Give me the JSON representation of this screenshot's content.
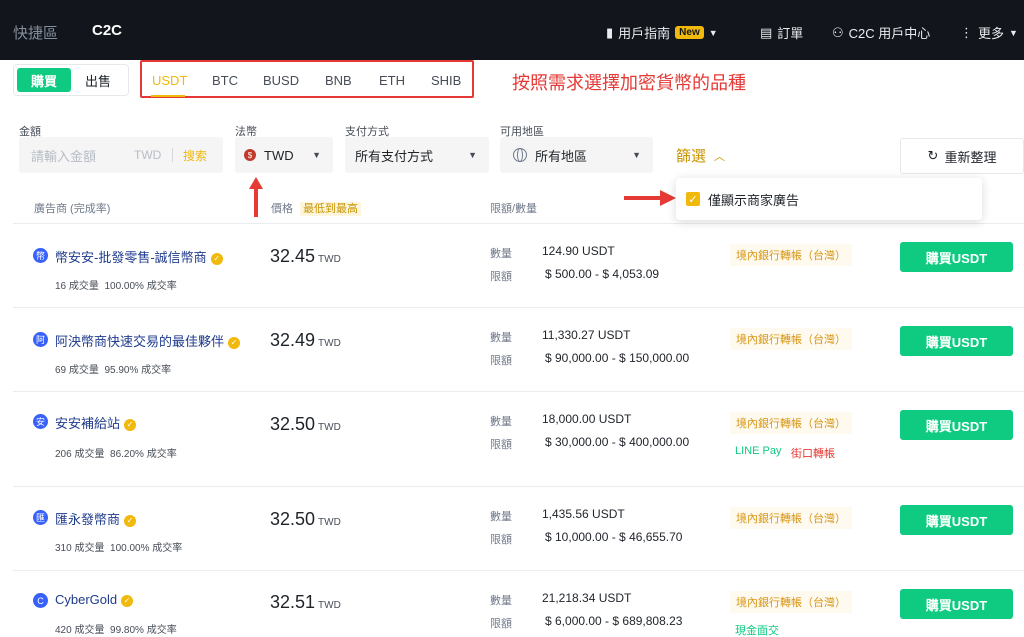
{
  "nav": {
    "left": [
      "快捷區",
      "C2C"
    ],
    "guide": "用戶指南",
    "new_badge": "New",
    "orders": "訂單",
    "user_center": "C2C 用戶中心",
    "more": "更多"
  },
  "trade": {
    "buy": "購買",
    "sell": "出售"
  },
  "coins": [
    "USDT",
    "BTC",
    "BUSD",
    "BNB",
    "ETH",
    "SHIB"
  ],
  "annotation_coin": "按照需求選擇加密貨幣的品種",
  "filters": {
    "amount_label": "金額",
    "amount_placeholder": "請輸入金額",
    "amount_unit": "TWD",
    "search": "搜索",
    "fiat_label": "法幣",
    "fiat_value": "TWD",
    "payment_label": "支付方式",
    "payment_value": "所有支付方式",
    "region_label": "可用地區",
    "region_value": "所有地區",
    "filter_toggle": "篩選",
    "refresh": "重新整理"
  },
  "popup": {
    "merchant_only": "僅顯示商家廣告"
  },
  "table": {
    "col_advertiser": "廣告商 (完成率)",
    "col_price": "價格",
    "sort": "最低到最高",
    "col_limit": "限額/數量",
    "qty_label": "數量",
    "limit_label": "限額",
    "buy_label": "購買USDT"
  },
  "rows": [
    {
      "avatar": "幣",
      "name": "幣安安-批發零售-誠信幣商",
      "trades": "16 成交量",
      "rate": "100.00% 成交率",
      "price": "32.45",
      "unit": "TWD",
      "qty": "124.90 USDT",
      "limit": "$ 500.00 - $ 4,053.09",
      "pay": [
        "境內銀行轉帳（台灣）"
      ]
    },
    {
      "avatar": "阿",
      "name": "阿泱幣商快速交易的最佳夥伴",
      "trades": "69 成交量",
      "rate": "95.90% 成交率",
      "price": "32.49",
      "unit": "TWD",
      "qty": "11,330.27 USDT",
      "limit": "$ 90,000.00 - $ 150,000.00",
      "pay": [
        "境內銀行轉帳（台灣）"
      ]
    },
    {
      "avatar": "安",
      "name": "安安補給站",
      "trades": "206 成交量",
      "rate": "86.20% 成交率",
      "price": "32.50",
      "unit": "TWD",
      "qty": "18,000.00 USDT",
      "limit": "$ 30,000.00 - $ 400,000.00",
      "pay": [
        "境內銀行轉帳（台灣）",
        "LINE Pay",
        "街口轉帳"
      ]
    },
    {
      "avatar": "匯",
      "name": "匯永發幣商",
      "trades": "310 成交量",
      "rate": "100.00% 成交率",
      "price": "32.50",
      "unit": "TWD",
      "qty": "1,435.56 USDT",
      "limit": "$ 10,000.00 - $ 46,655.70",
      "pay": [
        "境內銀行轉帳（台灣）"
      ]
    },
    {
      "avatar": "C",
      "name": "CyberGold",
      "trades": "420 成交量",
      "rate": "99.80% 成交率",
      "price": "32.51",
      "unit": "TWD",
      "qty": "21,218.34 USDT",
      "limit": "$ 6,000.00 - $ 689,808.23",
      "pay": [
        "境內銀行轉帳（台灣）",
        "現金面交"
      ]
    }
  ]
}
